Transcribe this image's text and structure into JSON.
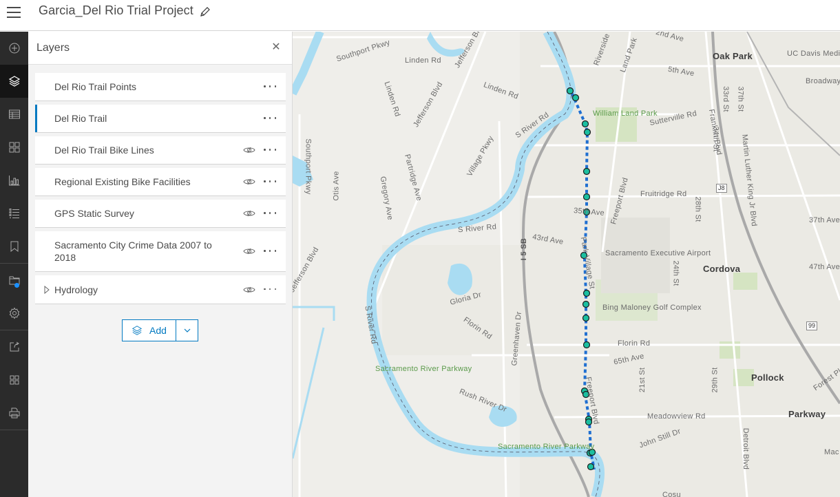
{
  "header": {
    "menu_icon": "hamburger-menu-icon",
    "title": "Garcia_Del Rio Trial Project",
    "edit_icon": "pencil-icon"
  },
  "action_bar": {
    "items": [
      {
        "name": "add",
        "icon": "plus-circle-icon",
        "active": false
      },
      {
        "name": "layers",
        "icon": "layers-icon",
        "active": true
      },
      {
        "name": "tables",
        "icon": "table-icon",
        "active": false
      },
      {
        "name": "basemap",
        "icon": "basemap-gallery-icon",
        "active": false
      },
      {
        "name": "charts",
        "icon": "bar-chart-icon",
        "active": false
      },
      {
        "name": "legend",
        "icon": "legend-list-icon",
        "active": false
      },
      {
        "name": "bookmarks",
        "icon": "bookmark-icon",
        "active": false
      },
      {
        "name": "map-properties",
        "icon": "folder-icon",
        "active": false,
        "badge": true
      },
      {
        "name": "settings",
        "icon": "gear-icon",
        "active": false
      },
      {
        "name": "share",
        "icon": "share-icon",
        "active": false
      },
      {
        "name": "apps",
        "icon": "grid-icon",
        "active": false
      },
      {
        "name": "print",
        "icon": "printer-icon",
        "active": false
      }
    ],
    "badge_color": "#1a90ff"
  },
  "layers_panel": {
    "title": "Layers",
    "close_icon": "close-icon",
    "layers": [
      {
        "name": "Del Rio Trail Points",
        "visible_toggle": false,
        "selected": false,
        "expandable": false
      },
      {
        "name": "Del Rio Trail",
        "visible_toggle": false,
        "selected": true,
        "expandable": false
      },
      {
        "name": "Del Rio Trail Bike Lines",
        "visible_toggle": true,
        "selected": false,
        "expandable": false
      },
      {
        "name": "Regional Existing Bike Facilities",
        "visible_toggle": true,
        "selected": false,
        "expandable": false
      },
      {
        "name": "GPS Static Survey",
        "visible_toggle": true,
        "selected": false,
        "expandable": false
      },
      {
        "name": "Sacramento City Crime Data 2007 to 2018",
        "visible_toggle": true,
        "selected": false,
        "expandable": false
      },
      {
        "name": "Hydrology",
        "visible_toggle": true,
        "selected": false,
        "expandable": true
      }
    ],
    "add_button": "Add",
    "accent_color": "#0079c1"
  },
  "map": {
    "labels": {
      "southport_pkwy_top": "Southport Pkwy",
      "southport_pkwy_left": "Southport Pkwy",
      "linden_rd_1": "Linden Rd",
      "linden_rd_2": "Linden Rd",
      "linden_rd_3": "Linden Rd",
      "jefferson_blvd_1": "Jefferson Blvd",
      "jefferson_blvd_2": "Jefferson Blvd",
      "jefferson_blvd_3": "Jefferson Blvd",
      "otis_ave": "Otis Ave",
      "gregory_ave": "Gregory Ave",
      "partridge_ave": "Partridge Ave",
      "village_pkwy": "Village Pkwy",
      "s_river_rd_1": "S River Rd",
      "s_river_rd_2": "S River Rd",
      "s_river_rd_3": "S River Rd",
      "i5_sb": "I 5 SB",
      "gloria_dr": "Gloria Dr",
      "florin_rd_west": "Florin Rd",
      "greenhaven_dr": "Greenhaven Dr",
      "rush_river_dr": "Rush River Dr",
      "sacramento_river_parkway_1": "Sacramento River Parkway",
      "sacramento_river_parkway_2": "Sacramento River Parkway",
      "riverside": "Riverside",
      "land_park": "Land Park",
      "second_ave": "2nd Ave",
      "fifth_ave": "5th Ave",
      "william_land_park": "William Land Park",
      "sutterville_rd": "Sutterville Rd",
      "franklin_blvd": "Franklin Blvd",
      "oak_park": "Oak Park",
      "uc_davis": "UC Davis Medical Center",
      "broadway": "Broadway",
      "33rd_st": "33rd St",
      "34th_st": "34th St",
      "37th_st": "37th St",
      "mlk_blvd": "Martin Luther King Jr Blvd",
      "fruitridge_rd": "Fruitridge Rd",
      "28th_st": "28th St",
      "freeport_blvd_1": "Freeport Blvd",
      "freeport_blvd_2": "Freeport Blvd",
      "35th_ave": "35th Ave",
      "37th_ave": "37th Ave",
      "43rd_ave": "43rd Ave",
      "park_village_st": "Park Village St",
      "sac_exec_airport": "Sacramento Executive Airport",
      "24th_st": "24th St",
      "cordova": "Cordova",
      "47th_ave": "47th Ave",
      "bing_maloney": "Bing Maloney Golf Complex",
      "florin_rd_east": "Florin Rd",
      "65th_ave": "65th Ave",
      "21st_st": "21st St",
      "29th_st": "29th St",
      "pollock": "Pollock",
      "forest_pkwy": "Forest Pkwy",
      "parkway": "Parkway",
      "meadowview_rd": "Meadowview Rd",
      "john_still_dr": "John Still Dr",
      "detroit_blvd": "Detroit Blvd",
      "mac": "Mac",
      "cosu": "Cosu"
    },
    "shields": {
      "j8": "J8",
      "hwy99": "99"
    },
    "trail": {
      "line_color": "#1f6fd1",
      "point_color": "#1bbfa0",
      "point_count": 20
    }
  }
}
